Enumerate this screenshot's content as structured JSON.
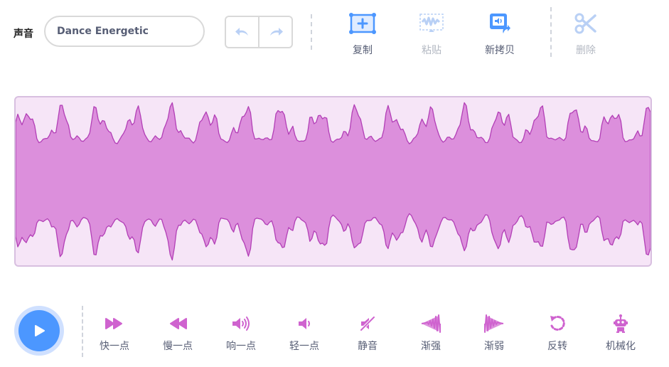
{
  "sound": {
    "label": "声音",
    "name_value": "Dance Energetic"
  },
  "toolbar": {
    "copy_label": "复制",
    "paste_label": "粘贴",
    "copy_to_new_label": "新拷贝",
    "delete_label": "删除"
  },
  "effects": [
    {
      "label": "快一点",
      "icon": "faster-icon"
    },
    {
      "label": "慢一点",
      "icon": "slower-icon"
    },
    {
      "label": "响一点",
      "icon": "louder-icon"
    },
    {
      "label": "轻一点",
      "icon": "softer-icon"
    },
    {
      "label": "静音",
      "icon": "mute-icon"
    },
    {
      "label": "渐强",
      "icon": "fade-in-icon"
    },
    {
      "label": "渐弱",
      "icon": "fade-out-icon"
    },
    {
      "label": "反转",
      "icon": "reverse-icon"
    },
    {
      "label": "机械化",
      "icon": "robot-icon"
    }
  ],
  "colors": {
    "accent": "#4c97ff",
    "effect_purple": "#cf63cf",
    "wave_fill": "#dc8fdc",
    "wave_stroke": "#b23fb6",
    "wave_bg": "#f6e5f7"
  }
}
